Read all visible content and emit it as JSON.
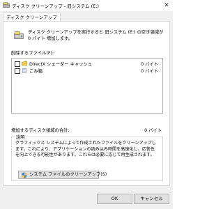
{
  "window": {
    "title": "ディスク クリーンアップ - 旧システム (E:)",
    "close_glyph": "✕"
  },
  "tabs": [
    {
      "label": "ディスク クリーンアップ"
    }
  ],
  "header": {
    "description": "ディスク クリーンアップを実行すると 旧システム (E:) の空き領域が 0 バイト 増加します。"
  },
  "files_section": {
    "label": "削除するファイル(F):",
    "items": [
      {
        "name": "DirectX シェーダー キャッシュ",
        "size": "0 バイト",
        "checked": false,
        "icon": "folder-icon"
      },
      {
        "name": "ごみ箱",
        "size": "0 バイト",
        "checked": false,
        "icon": "recycle-bin-icon"
      }
    ]
  },
  "total": {
    "label": "増加するディスク領域の合計:",
    "value": "0 バイト"
  },
  "description_group": {
    "title": "説明",
    "text": "グラフィックス システムによって作成されたファイルをクリーンアップします。これにより、アプリケーションの読み込み時間を高速化し、応答性を向上できる可能性があります。これらは必要に応じて再生成されます。"
  },
  "cleanup_button": {
    "label": "システム ファイルのクリーンアップ(S)",
    "icon": "shield-icon"
  },
  "footer": {
    "ok_label": "OK",
    "cancel_label": "キャンセル"
  },
  "colors": {
    "window_bg": "#f0f0f0",
    "panel_bg": "#ffffff",
    "button_bg": "#e1e1e1",
    "border": "#adadad"
  }
}
